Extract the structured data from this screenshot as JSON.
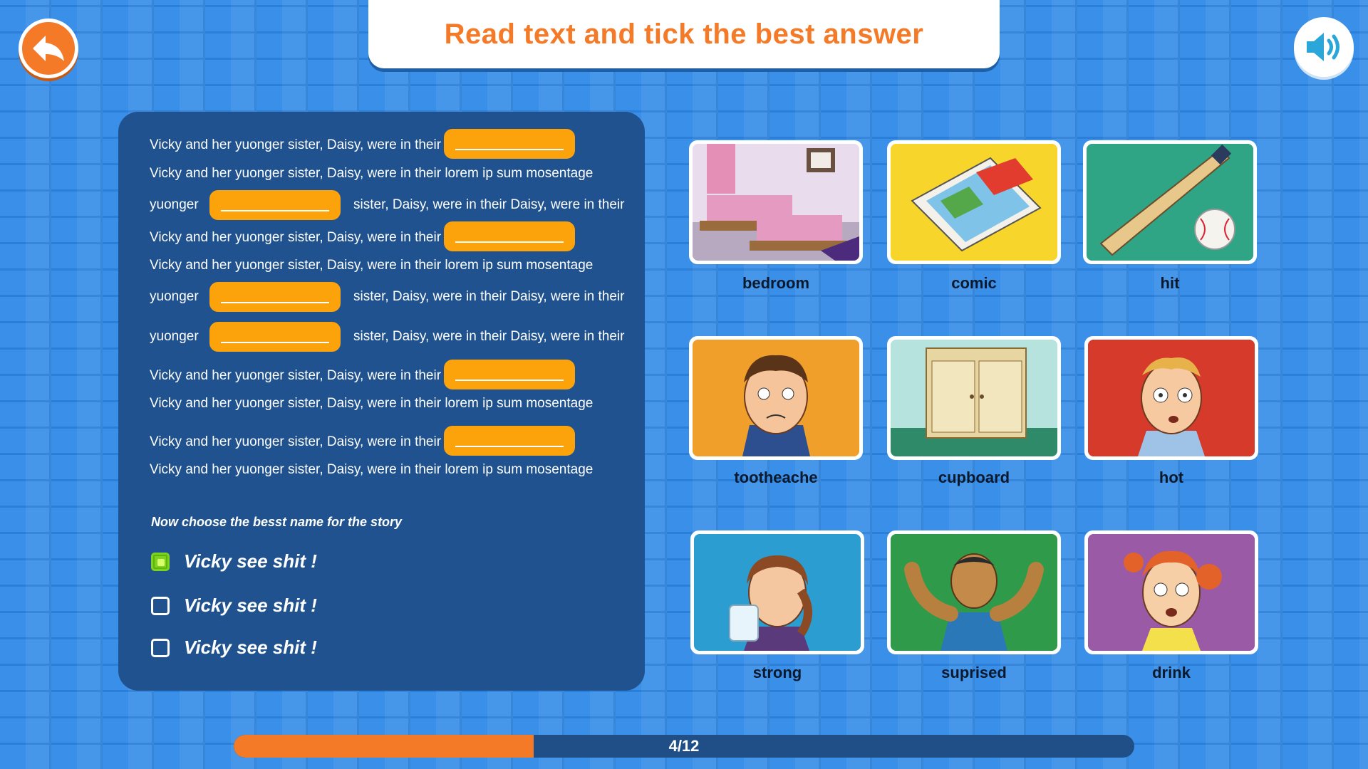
{
  "header": {
    "title": "Read text and tick the best answer"
  },
  "controls": {
    "back_icon": "back-arrow-icon",
    "sound_icon": "speaker-icon"
  },
  "story": {
    "lines": [
      "Vicky and her yuonger sister, Daisy, were in their",
      "Vicky and her yuonger sister, Daisy, were in their  lorem ip sum mosentage",
      "yuonger",
      "sister, Daisy, were in their Daisy, were in their",
      "Vicky and her yuonger sister, Daisy, were in their",
      "Vicky and her yuonger sister, Daisy, were in their  lorem ip sum mosentage",
      "yuonger",
      "sister, Daisy, were in their Daisy, were in their",
      "yuonger",
      "sister, Daisy, were in their Daisy, were in their",
      "Vicky and her yuonger sister, Daisy, were in their",
      "Vicky and her yuonger sister, Daisy, were in their  lorem ip sum mosentage",
      "Vicky and her yuonger sister, Daisy, were in their",
      "Vicky and her yuonger sister, Daisy, were in their  lorem ip sum mosentage"
    ],
    "blanks_count_visible": 7
  },
  "question": {
    "prompt": "Now choose the besst name for the story",
    "options": [
      {
        "label": "Vicky see shit !",
        "checked": true
      },
      {
        "label": "Vicky see shit !",
        "checked": false
      },
      {
        "label": "Vicky see shit !",
        "checked": false
      }
    ]
  },
  "pictures": [
    {
      "label": "bedroom"
    },
    {
      "label": "comic"
    },
    {
      "label": "hit"
    },
    {
      "label": "tootheache"
    },
    {
      "label": "cupboard"
    },
    {
      "label": "hot"
    },
    {
      "label": "strong"
    },
    {
      "label": "suprised"
    },
    {
      "label": "drink"
    }
  ],
  "progress": {
    "current": 4,
    "total": 12,
    "text": "4/12",
    "fraction": 0.333
  },
  "colors": {
    "accent": "#f47a27",
    "blank": "#fca20b",
    "panel": "#1f528e",
    "check": "#7ed321"
  }
}
